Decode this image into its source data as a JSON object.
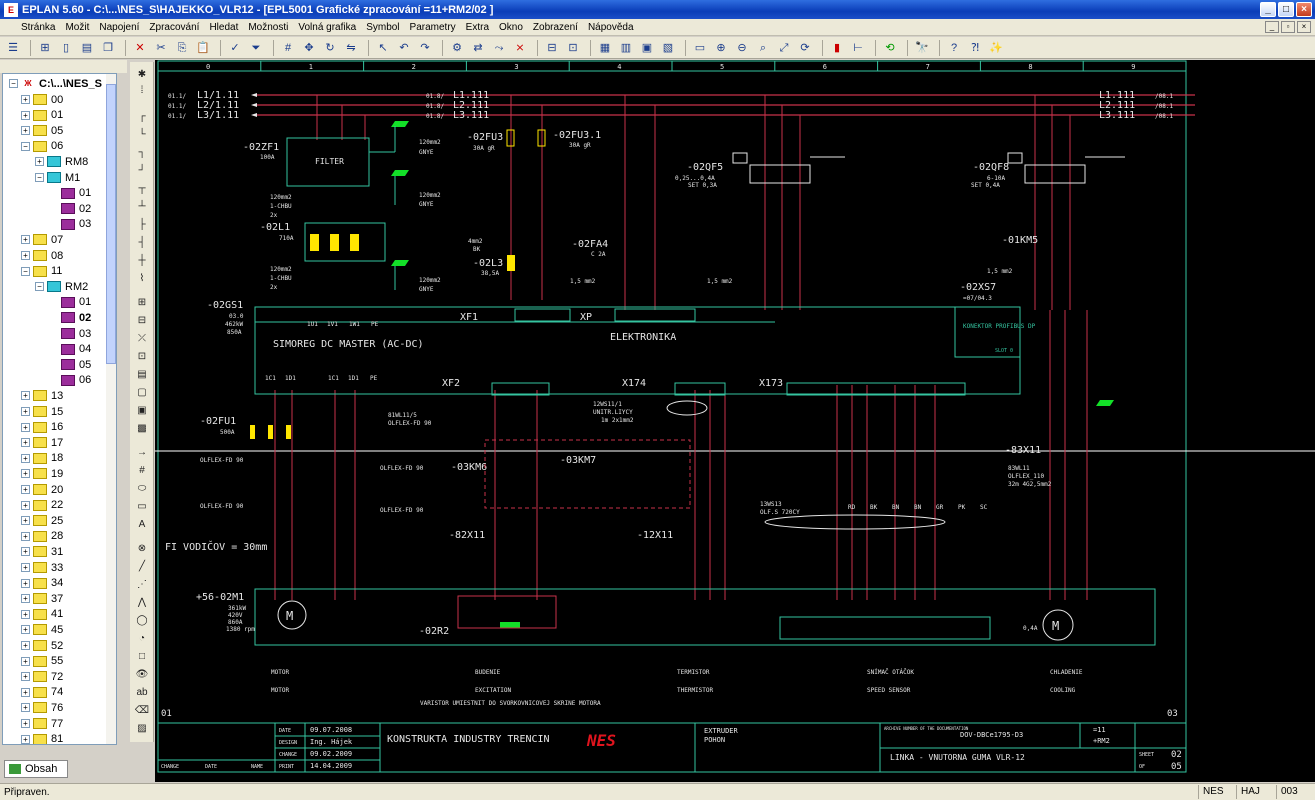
{
  "window": {
    "title": "EPLAN 5.60 - C:\\...\\NES_S\\HAJEKKO_VLR12 - [EPL5001 Grafické zpracování  =11+RM2/02 ]",
    "app_icon": "E"
  },
  "menu": [
    "Stránka",
    "Možit",
    "Napojení",
    "Zpracování",
    "Hledat",
    "Možnosti",
    "Volná grafika",
    "Symbol",
    "Parametry",
    "Extra",
    "Okno",
    "Zobrazení",
    "Nápověda"
  ],
  "tree": {
    "root": "C:\\...\\NES_S",
    "nodes": [
      {
        "label": "00"
      },
      {
        "label": "01"
      },
      {
        "label": "05"
      },
      {
        "label": "06"
      },
      {
        "label": "RM8"
      },
      {
        "label": "M1"
      },
      {
        "label": "01"
      },
      {
        "label": "02"
      },
      {
        "label": "03"
      },
      {
        "label": "07"
      },
      {
        "label": "08"
      },
      {
        "label": "11"
      },
      {
        "label": "RM2"
      },
      {
        "label": "01"
      },
      {
        "label": "02"
      },
      {
        "label": "03"
      },
      {
        "label": "04"
      },
      {
        "label": "05"
      },
      {
        "label": "06"
      },
      {
        "label": "13"
      },
      {
        "label": "15"
      },
      {
        "label": "16"
      },
      {
        "label": "17"
      },
      {
        "label": "18"
      },
      {
        "label": "19"
      },
      {
        "label": "20"
      },
      {
        "label": "22"
      },
      {
        "label": "25"
      },
      {
        "label": "28"
      },
      {
        "label": "31"
      },
      {
        "label": "33"
      },
      {
        "label": "34"
      },
      {
        "label": "37"
      },
      {
        "label": "41"
      },
      {
        "label": "45"
      },
      {
        "label": "52"
      },
      {
        "label": "55"
      },
      {
        "label": "72"
      },
      {
        "label": "74"
      },
      {
        "label": "76"
      },
      {
        "label": "77"
      },
      {
        "label": "81"
      }
    ],
    "tab_label": "Obsah"
  },
  "schematic": {
    "columns": [
      "0",
      "1",
      "2",
      "3",
      "4",
      "5",
      "6",
      "7",
      "8",
      "9"
    ],
    "bus_left": [
      "L1/1.11",
      "L2/1.11",
      "L3/1.11"
    ],
    "bus_left_ref": [
      "01.1/",
      "01.1/",
      "01.1/"
    ],
    "bus_mid": [
      "L1.111",
      "L2.111",
      "L3.111"
    ],
    "bus_mid_ref": [
      "01.8/",
      "01.8/",
      "01.8/"
    ],
    "bus_right": [
      "L1.111",
      "L2.111",
      "L3.111"
    ],
    "bus_right_ref": [
      "/08.1",
      "/08.1",
      "/08.1"
    ],
    "filter_ref": "-02ZF1",
    "filter_amp": "100A",
    "filter_label": "FILTER",
    "fuse1": "-02FU3",
    "fuse1_spec": "30A  gR",
    "fuse2": "-02FU3.1",
    "fuse2_spec": "30A  gR",
    "qf5": "-02QF5",
    "qf5_spec": "0,25...0,4A",
    "qf5_set": "SET 0,3A",
    "qf8": "-02QF8",
    "qf8_spec": "6-10A",
    "qf8_set": "SET 0,4A",
    "choke": "-02L1",
    "choke_amp": "710A",
    "choke2": "-02L3",
    "choke2_amp": "38,5A",
    "fa4": "-02FA4",
    "fa4_spec": "C 2A",
    "km5": "-01KM5",
    "cable_120": "120mm2",
    "cable_1chbu": "1-CHBU",
    "cable_2x": "2x",
    "cable_gnye": "GNYE",
    "cable_4mm": "4mm2",
    "cable_bk": "BK",
    "cable_15": "1,5 mm2",
    "drive_ref": "-02GS1",
    "drive_spec1": "03.0",
    "drive_spec2": "462kW",
    "drive_spec3": "850A",
    "drive_name": "SIMOREG DC MASTER (AC-DC)",
    "elektronika": "ELEKTRONIKA",
    "xs7": "-02XS7",
    "xs7_ref": "=07/04.3",
    "konektor": "KONEKTOR PROFIBUS DP",
    "slot": "SLOT 0",
    "xf1": "XF1",
    "xp": "XP",
    "xf2": "XF2",
    "x174": "X174",
    "x173": "X173",
    "terminals_top": [
      "1U1",
      "1V1",
      "1W1",
      "PE"
    ],
    "terminals_mid": [
      "1C1",
      "1D1",
      "1C1",
      "1D1",
      "PE"
    ],
    "fu1": "-02FU1",
    "fu1_spec": "500A",
    "cable_81": "81WL11/5",
    "cable_olflex": "OLFLEX-FD 90",
    "km6": "-03KM6",
    "km7": "-03KM7",
    "x11_82": "-82X11",
    "x11_12": "-12X11",
    "x11_83": "-83X11",
    "cable_12ws11": "12WS11/1",
    "cable_unitr": "UNITR.LIYCY",
    "cable_unitr_spec": "1m 2x1mm2",
    "cable_83": "83WL11",
    "cable_olflex110": "OLFLEX_110",
    "cable_83spec": "32m 4G2,5mm2",
    "cable_ws13": "13WS13",
    "cable_ws13spec": "OLF.S 720CY",
    "wire_colors": [
      "RD",
      "BK",
      "BN",
      "BN",
      "GR",
      "PK",
      "SC"
    ],
    "cross_section": "FI VODIČOV = 30mm",
    "motor_ref": "+56-02M1",
    "motor_spec1": "361kW",
    "motor_spec2": "420V",
    "motor_spec3": "860A",
    "motor_spec4": "1380 rpm",
    "r2": "-02R2",
    "sections": [
      {
        "cz": "MOTOR",
        "en": "MOTOR"
      },
      {
        "cz": "BUDENIE",
        "en": "EXCITATION"
      },
      {
        "cz": "TERMISTOR",
        "en": "THERMISTOR"
      },
      {
        "cz": "SNÍMAČ OTÁČOK",
        "en": "SPEED SENSOR"
      },
      {
        "cz": "CHLADENIE",
        "en": "COOLING"
      }
    ],
    "note": "VARISTOR UMIESTNIT DO SVORKOVNICOVEJ SKRINE MOTORA",
    "cooling_motor_spec": "0,4A",
    "page_left": "01",
    "page_right": "03"
  },
  "titleblock": {
    "rows": [
      {
        "label": "DATE",
        "value": "09.07.2008"
      },
      {
        "label": "DESIGN",
        "value": "Ing. Hájek"
      },
      {
        "label": "CHANGE",
        "value": "09.02.2009"
      },
      {
        "label": "PRINT",
        "value": "14.04.2009"
      }
    ],
    "foot": [
      "CHANGE",
      "DATE",
      "NAME"
    ],
    "company": "KONSTRUKTA INDUSTRY TRENCIN",
    "logo": "NES",
    "project1": "EXTRUDER",
    "project2": "POHON",
    "archive_label": "ARCHIVE NUMBER OF THE DOCUMENTATION",
    "archive": "DOV-DBCe1795-D3",
    "line": "LINKA - VNUTORNA GUMA VLR-12",
    "ref1": "=11",
    "ref2": "+RM2",
    "sheet_label": "SHEET",
    "sheet": "02",
    "of_label": "OF",
    "of": "05"
  },
  "status": {
    "text": "Připraven.",
    "c1": "NES",
    "c2": "HAJ",
    "c3": "003"
  },
  "colors": {
    "wire": "#c8324a",
    "line": "#35c4a0",
    "text": "#e6e6e6",
    "component": "#ffe600",
    "pe": "#13e028"
  }
}
